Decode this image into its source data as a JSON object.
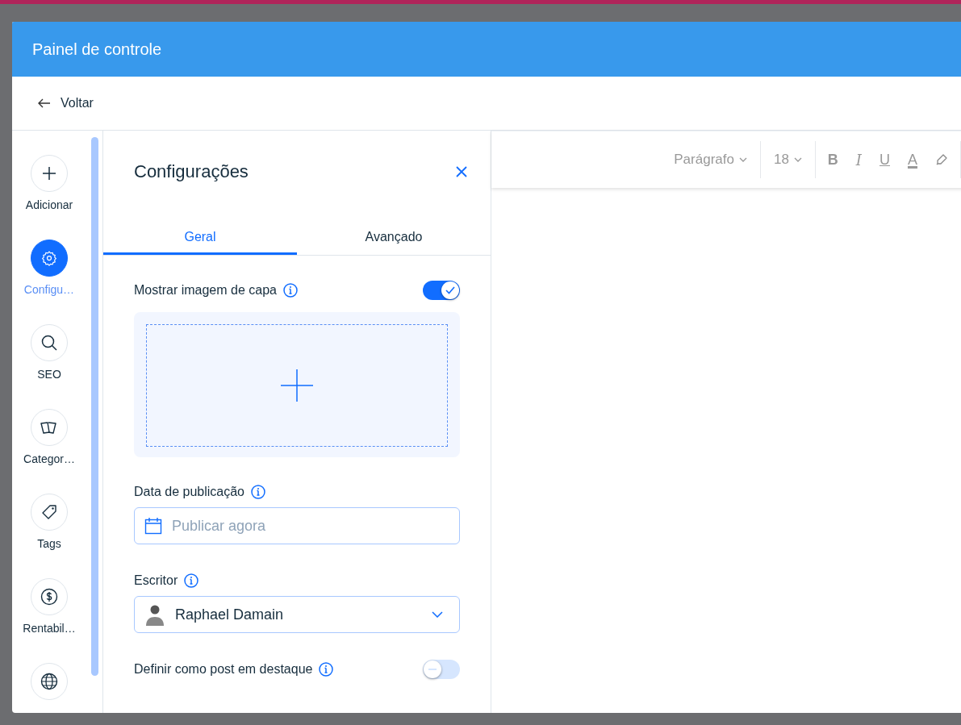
{
  "header": {
    "title": "Painel de controle"
  },
  "back": {
    "label": "Voltar"
  },
  "sidebar": {
    "items": [
      {
        "label": "Adicionar",
        "selected": false
      },
      {
        "label": "Configu…",
        "selected": true
      },
      {
        "label": "SEO",
        "selected": false
      },
      {
        "label": "Categor…",
        "selected": false
      },
      {
        "label": "Tags",
        "selected": false
      },
      {
        "label": "Rentabil…",
        "selected": false
      },
      {
        "selected": false
      }
    ]
  },
  "settings": {
    "title": "Configurações",
    "tabs": [
      {
        "label": "Geral",
        "selected": true
      },
      {
        "label": "Avançado",
        "selected": false
      }
    ],
    "cover_image": {
      "label": "Mostrar imagem de capa",
      "on": true
    },
    "publish_date": {
      "label": "Data de publicação",
      "placeholder": "Publicar agora"
    },
    "writer": {
      "label": "Escritor",
      "value": "Raphael Damain"
    },
    "featured": {
      "label": "Definir como post em destaque",
      "on": false
    }
  },
  "toolbar": {
    "style": "Parágrafo",
    "size": "18",
    "format_buttons": [
      "B",
      "I",
      "U",
      "A"
    ]
  }
}
